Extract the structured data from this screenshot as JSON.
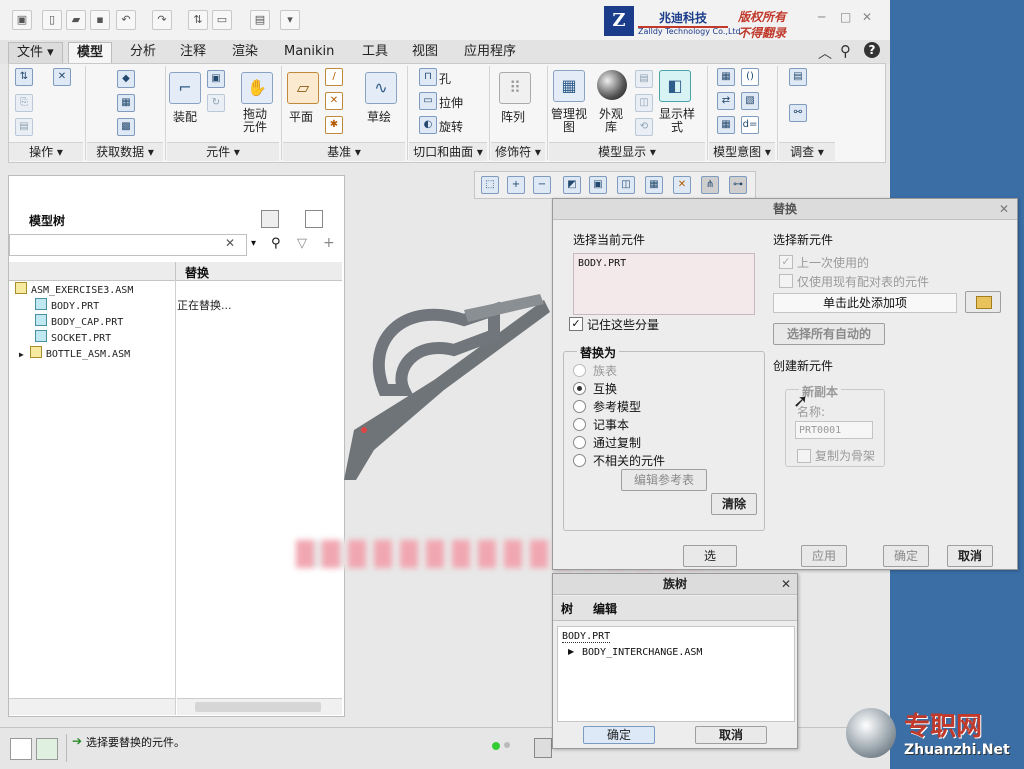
{
  "brand": {
    "company_cn": "兆迪科技",
    "company_en": "Zalldy Technology Co.,Ltd.",
    "slogan_line1": "版权所有",
    "slogan_line2": "不得翻录",
    "logo_letter": "Z"
  },
  "tabs": [
    {
      "label": "文件"
    },
    {
      "label": "模型"
    },
    {
      "label": "分析"
    },
    {
      "label": "注释"
    },
    {
      "label": "渲染"
    },
    {
      "label": "Manikin"
    },
    {
      "label": "工具"
    },
    {
      "label": "视图"
    },
    {
      "label": "应用程序"
    }
  ],
  "ribbon": {
    "groups": [
      "操作",
      "获取数据",
      "元件",
      "基准",
      "切口和曲面",
      "修饰符",
      "模型显示",
      "模型意图",
      "调查"
    ],
    "buttons": {
      "assemble": "装配",
      "drag": "拖动\n元件",
      "plane": "平面",
      "sketch": "草绘",
      "hole": "孔",
      "extrude": "拉伸",
      "revolve": "旋转",
      "pattern": "阵列",
      "manage_view": "管理视\n图",
      "appearance": "外观\n库",
      "display_style": "显示样\n式"
    }
  },
  "model_tree": {
    "title": "模型树",
    "column_header": "替换",
    "rows": [
      {
        "name": "ASM_EXERCISE3.ASM",
        "type": "asm",
        "status": ""
      },
      {
        "name": "BODY.PRT",
        "type": "part",
        "status": "正在替换..."
      },
      {
        "name": "BODY_CAP.PRT",
        "type": "part",
        "status": ""
      },
      {
        "name": "SOCKET.PRT",
        "type": "part",
        "status": ""
      },
      {
        "name": "BOTTLE_ASM.ASM",
        "type": "asm",
        "status": ""
      }
    ]
  },
  "replace_dialog": {
    "title": "替换",
    "select_current": "选择当前元件",
    "current_item": "BODY.PRT",
    "remember_label": "记住这些分量",
    "replace_by_group": "替换为",
    "options": [
      "族表",
      "互换",
      "参考模型",
      "记事本",
      "通过复制",
      "不相关的元件"
    ],
    "selected_option": "互换",
    "edit_ref_table": "编辑参考表",
    "clear": "清除",
    "select_new": "选择新元件",
    "last_used": "上一次使用的",
    "use_existing_pairs": "仅使用现有配对表的元件",
    "add_item": "单击此处添加项",
    "select_all_auto": "选择所有自动的",
    "create_new": "创建新元件",
    "new_copy_group": "新副本",
    "name_label": "名称:",
    "name_value": "PRT0001",
    "copy_as_skeleton": "复制为骨架",
    "partial_button": "选",
    "apply": "应用",
    "ok": "确定",
    "cancel": "取消"
  },
  "family_tree": {
    "title": "族树",
    "menu_tree": "树",
    "menu_edit": "编辑",
    "items": [
      "BODY.PRT",
      "BODY_INTERCHANGE.ASM"
    ],
    "ok": "确定",
    "cancel": "取消"
  },
  "status": {
    "message": "选择要替换的元件。"
  },
  "watermark": {
    "cn": "专职网",
    "url": "Zhuanzhi.Net"
  },
  "colors": {
    "desktop": "#3a6ea5",
    "accent_red": "#c0392b",
    "brand_blue": "#1a3c8a"
  }
}
